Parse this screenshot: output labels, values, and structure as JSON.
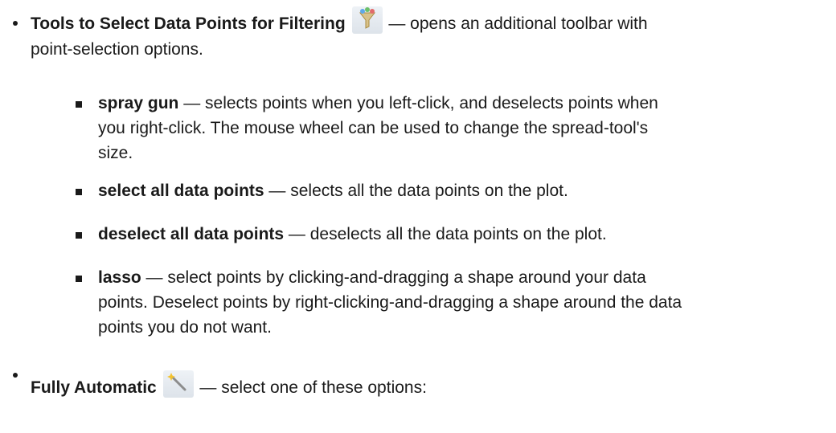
{
  "top": {
    "title": "Tools to Select Data Points for Filtering",
    "icon": "filter-funnel-icon",
    "dash_text": " — opens an additional toolbar with",
    "line2": "point-selection options."
  },
  "sub_items": [
    {
      "term": "spray gun",
      "lines": [
        " — selects points when you left-click, and deselects points when",
        "you right-click. The mouse wheel can be used to change the spread-tool's",
        "size."
      ]
    },
    {
      "term": "select all data points",
      "lines": [
        " — selects all the data points on the plot."
      ]
    },
    {
      "term": "deselect all data points",
      "lines": [
        " — deselects all the data points on the plot."
      ]
    },
    {
      "term": "lasso",
      "lines": [
        " — select points by clicking-and-dragging a shape around your data",
        "points. Deselect points by right-clicking-and-dragging a shape around the data",
        "points you do not want."
      ]
    }
  ],
  "bottom": {
    "title": "Fully Automatic",
    "icon": "magic-wand-icon",
    "dash_text": " — select one of these options:"
  }
}
